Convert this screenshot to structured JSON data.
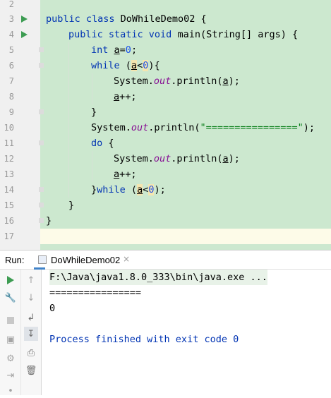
{
  "editor": {
    "line_numbers": [
      "2",
      "3",
      "4",
      "5",
      "6",
      "7",
      "8",
      "9",
      "10",
      "11",
      "12",
      "13",
      "14",
      "15",
      "16",
      "17"
    ],
    "lines": {
      "l3": {
        "kw1": "public class ",
        "name": "DoWhileDemo02 {"
      },
      "l4": {
        "kw1": "public static void ",
        "name": "main",
        "rest": "(String[] args) {"
      },
      "l5": {
        "kw": "int ",
        "var": "a",
        "eq": "=",
        "num": "0",
        "end": ";"
      },
      "l6": {
        "kw": "while ",
        "open": "(",
        "var": "a",
        "lt": "<",
        "num": "0",
        "close": "){"
      },
      "l7": {
        "pre": "System.",
        "fld": "out",
        "mid": ".println(",
        "var": "a",
        "end": ");"
      },
      "l8": {
        "var": "a",
        "end": "++;"
      },
      "l9": {
        "text": "}"
      },
      "l10": {
        "pre": "System.",
        "fld": "out",
        "mid": ".println(",
        "str": "\"================\"",
        "end": ");"
      },
      "l11": {
        "kw": "do ",
        "end": "{"
      },
      "l12": {
        "pre": "System.",
        "fld": "out",
        "mid": ".println(",
        "var": "a",
        "end": ");"
      },
      "l13": {
        "var": "a",
        "end": "++;"
      },
      "l14": {
        "pre": "}",
        "kw": "while ",
        "open": "(",
        "var": "a",
        "lt": "<",
        "num": "0",
        "close": ");"
      },
      "l15": {
        "text": "}"
      },
      "l16": {
        "text": "}"
      }
    }
  },
  "run_panel": {
    "label": "Run:",
    "tab_title": "DoWhileDemo02",
    "tab_close": "×",
    "console": [
      "F:\\Java\\java1.8.0_333\\bin\\java.exe ...",
      "================",
      "0",
      "",
      "Process finished with exit code 0"
    ]
  },
  "colors": {
    "keyword": "#0033b3",
    "field": "#871094",
    "number": "#1750eb",
    "string": "#067d17",
    "code_background": "#cce8cf",
    "run_icon": "#3d9c52",
    "console_process_text": "#0033b3",
    "tab_underline": "#4083c9"
  },
  "icons": {
    "gutter": [
      "run-gutter-icon",
      "run-gutter-icon"
    ],
    "toolbar_left": [
      "rerun-icon",
      "wrench-icon",
      "stop-icon",
      "camera-icon",
      "settings-gear-icon",
      "login-icon",
      "pin-icon"
    ],
    "toolbar_right": [
      "arrow-up-icon",
      "arrow-down-icon",
      "soft-wrap-icon",
      "scroll-to-end-icon",
      "print-icon",
      "trash-icon"
    ]
  }
}
